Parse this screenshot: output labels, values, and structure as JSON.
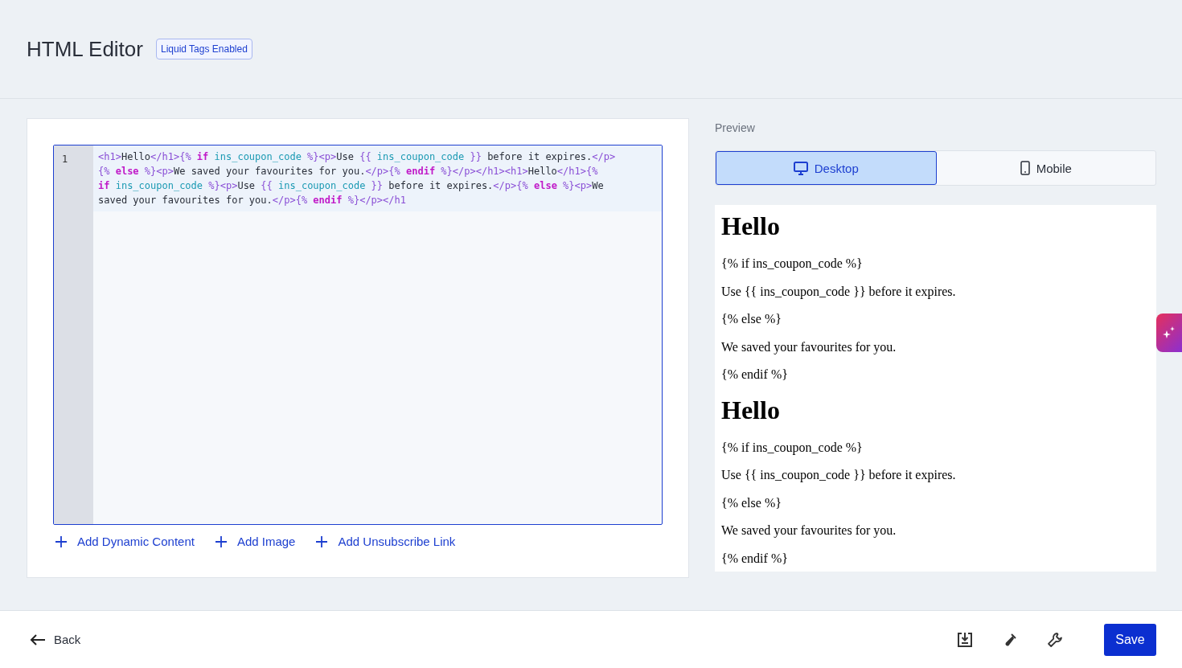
{
  "header": {
    "title": "HTML Editor",
    "badge": "Liquid Tags Enabled"
  },
  "editor": {
    "line_number": "1",
    "tokens": [
      {
        "kind": "tag",
        "text": "<h1>"
      },
      {
        "kind": "text",
        "text": "Hello"
      },
      {
        "kind": "tag",
        "text": "</h1>"
      },
      {
        "kind": "delim",
        "text": "{% "
      },
      {
        "kind": "keyword",
        "text": "if"
      },
      {
        "kind": "var",
        "text": " ins_coupon_code"
      },
      {
        "kind": "delim",
        "text": " %}"
      },
      {
        "kind": "tag",
        "text": "<p>"
      },
      {
        "kind": "text",
        "text": "Use "
      },
      {
        "kind": "delim",
        "text": "{{ "
      },
      {
        "kind": "var",
        "text": "ins_coupon_code"
      },
      {
        "kind": "delim",
        "text": " }}"
      },
      {
        "kind": "text",
        "text": " before it expires."
      },
      {
        "kind": "tag",
        "text": "</p>"
      },
      {
        "kind": "wrap"
      },
      {
        "kind": "delim",
        "text": "{% "
      },
      {
        "kind": "keyword",
        "text": "else"
      },
      {
        "kind": "delim",
        "text": " %}"
      },
      {
        "kind": "tag",
        "text": "<p>"
      },
      {
        "kind": "text",
        "text": "We saved your favourites for you."
      },
      {
        "kind": "tag",
        "text": "</p>"
      },
      {
        "kind": "delim",
        "text": "{% "
      },
      {
        "kind": "keyword",
        "text": "endif"
      },
      {
        "kind": "delim",
        "text": " %}"
      },
      {
        "kind": "tag",
        "text": "</p></h1><h1>"
      },
      {
        "kind": "text",
        "text": "Hello"
      },
      {
        "kind": "tag",
        "text": "</h1>"
      },
      {
        "kind": "delim",
        "text": "{%"
      },
      {
        "kind": "wrap"
      },
      {
        "kind": "keyword",
        "text": "if"
      },
      {
        "kind": "var",
        "text": " ins_coupon_code"
      },
      {
        "kind": "delim",
        "text": " %}"
      },
      {
        "kind": "tag",
        "text": "<p>"
      },
      {
        "kind": "text",
        "text": "Use "
      },
      {
        "kind": "delim",
        "text": "{{ "
      },
      {
        "kind": "var",
        "text": "ins_coupon_code"
      },
      {
        "kind": "delim",
        "text": " }}"
      },
      {
        "kind": "text",
        "text": " before it expires."
      },
      {
        "kind": "tag",
        "text": "</p>"
      },
      {
        "kind": "delim",
        "text": "{% "
      },
      {
        "kind": "keyword",
        "text": "else"
      },
      {
        "kind": "delim",
        "text": " %}"
      },
      {
        "kind": "tag",
        "text": "<p>"
      },
      {
        "kind": "text",
        "text": "We"
      },
      {
        "kind": "wrap"
      },
      {
        "kind": "text",
        "text": "saved your favourites for you."
      },
      {
        "kind": "tag",
        "text": "</p>"
      },
      {
        "kind": "delim",
        "text": "{% "
      },
      {
        "kind": "keyword",
        "text": "endif"
      },
      {
        "kind": "delim",
        "text": " %}"
      },
      {
        "kind": "tag",
        "text": "</p></h1"
      }
    ]
  },
  "actions": [
    "Add Dynamic Content",
    "Add Image",
    "Add Unsubscribe Link"
  ],
  "preview": {
    "label": "Preview",
    "tabs": [
      {
        "label": "Desktop",
        "kind": "desktop",
        "selected": true
      },
      {
        "label": "Mobile",
        "kind": "mobile",
        "selected": false
      }
    ],
    "blocks": [
      {
        "kind": "h1",
        "text": "Hello"
      },
      {
        "kind": "p",
        "text": "{% if ins_coupon_code %}"
      },
      {
        "kind": "p",
        "text": "Use {{ ins_coupon_code }} before it expires."
      },
      {
        "kind": "p",
        "text": "{% else %}"
      },
      {
        "kind": "p",
        "text": "We saved your favourites for you."
      },
      {
        "kind": "p",
        "text": "{% endif %}"
      },
      {
        "kind": "h1",
        "text": "Hello"
      },
      {
        "kind": "p",
        "text": "{% if ins_coupon_code %}"
      },
      {
        "kind": "p",
        "text": "Use {{ ins_coupon_code }} before it expires."
      },
      {
        "kind": "p",
        "text": "{% else %}"
      },
      {
        "kind": "p",
        "text": "We saved your favourites for you."
      },
      {
        "kind": "p",
        "text": "{% endif %}"
      }
    ]
  },
  "footer": {
    "back": "Back",
    "save": "Save"
  }
}
